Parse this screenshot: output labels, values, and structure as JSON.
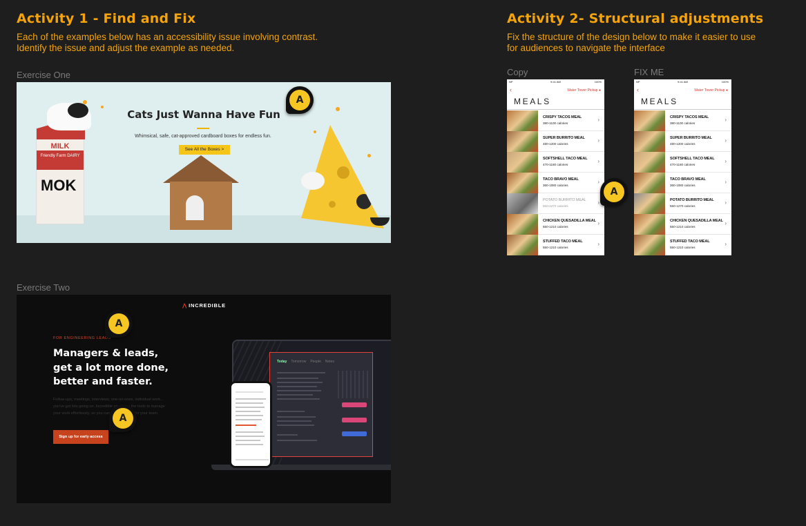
{
  "activity1": {
    "title": "Activity 1 - Find and Fix",
    "subtitle_line1": "Each of the examples below has an accessibility issue involving contrast.",
    "subtitle_line2": "Identify the issue and adjust the example as needed."
  },
  "activity2": {
    "title": "Activity 2- Structural adjustments",
    "subtitle_line1": "Fix the structure of the design below to make it easier to use",
    "subtitle_line2": "for audiences to navigate the interface"
  },
  "badge_letter": "A",
  "exercise_one": {
    "label": "Exercise One",
    "title": "Cats Just Wanna Have Fun",
    "tagline": "Whimsical, safe,  cat-approved cardboard boxes for endless fun.",
    "button": "See All the Boxes >",
    "carton_brand": "MILK",
    "carton_sub": "Friendly Farm DAIRY",
    "carton_mark": "MOK"
  },
  "exercise_two": {
    "label": "Exercise Two",
    "brand": "INCREDIBLE",
    "eyebrow": "FOR ENGINEERING LEADS",
    "headline": "Managers & leads, get a lot more done, better and faster.",
    "body": "Follow-ups, meetings, interviews, one-on-ones, individual work... you've got lots going on. Incredible gives you the tools to manage your work effortlessly, so you can be the leader for your team.",
    "cta": "Sign up for early access",
    "app_tabs": {
      "today": "Today",
      "tomorrow": "Tomorrow",
      "people": "People",
      "notes": "Notes"
    }
  },
  "copy_label": "Copy",
  "fix_label": "FIX ME",
  "mobile": {
    "time": "9:41 AM",
    "carrier": "NP",
    "battery": "100%",
    "pickup": "Water Tower Pickup",
    "title": "MEALS",
    "copy_rows": [
      {
        "name": "CRISPY TACOS MEAL",
        "cal": "380-1100 calories"
      },
      {
        "name": "SUPER BURRITO MEAL",
        "cal": "480-1200 calories"
      },
      {
        "name": "SOFTSHELL TACO MEAL",
        "cal": "470-1180 calories"
      },
      {
        "name": "TACO BRAVO MEAL",
        "cal": "360-1080 calories"
      },
      {
        "name": "POTATO BURRITO MEAL",
        "cal": "550-1270 calories"
      },
      {
        "name": "CHICKEN QUESADILLA MEAL",
        "cal": "550-1210 calories"
      },
      {
        "name": "STUFFED TACO MEAL",
        "cal": "550-1210 calories"
      }
    ],
    "fix_rows": [
      {
        "name": "CRISPY TACOS MEAL",
        "cal": "380-1100 calories"
      },
      {
        "name": "SUPER BURRITO MEAL",
        "cal": "480-1200 calories"
      },
      {
        "name": "SOFTSHELL TACO MEAL",
        "cal": "470-1180 calories"
      },
      {
        "name": "TACO BRAVO MEAL",
        "cal": "360-1080 calories"
      },
      {
        "name": "POTATO BURRITO MEAL",
        "cal": "550-1270 calories"
      },
      {
        "name": "CHICKEN QUESADILLA MEAL",
        "cal": "550-1210 calories"
      },
      {
        "name": "STUFFED TACO MEAL",
        "cal": "550-1210 calories"
      }
    ]
  },
  "colors": {
    "accent": "#f4a40a",
    "badge": "#f6c623",
    "brand_red": "#d93a30"
  }
}
